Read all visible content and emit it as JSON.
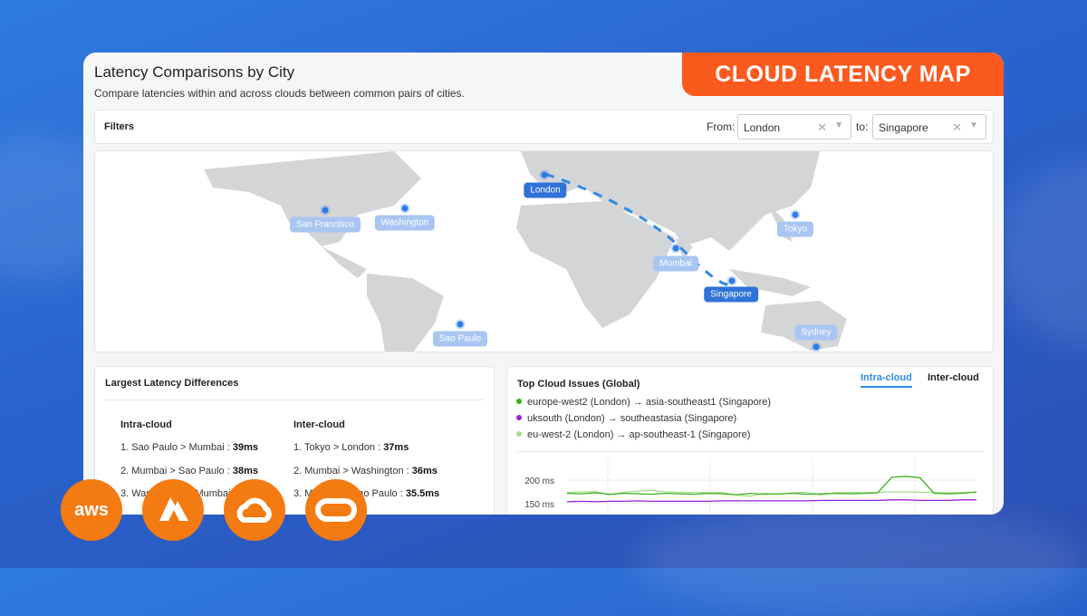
{
  "banner": "CLOUD LATENCY MAP",
  "header": {
    "title": "Latency Comparisons by City",
    "subtitle": "Compare latencies within and across clouds between common pairs of cities."
  },
  "filters": {
    "label": "Filters",
    "from_label": "From:",
    "from_value": "London",
    "to_label": "to:",
    "to_value": "Singapore"
  },
  "map": {
    "cities": [
      "San Francisco",
      "Washington",
      "London",
      "Mumbai",
      "Singapore",
      "Tokyo",
      "Sao Paulo",
      "Sydney"
    ],
    "selected": [
      "London",
      "Singapore"
    ]
  },
  "differences": {
    "title": "Largest Latency Differences",
    "intra": {
      "heading": "Intra-cloud",
      "items": [
        {
          "text": "1. Sao Paulo > Mumbai : ",
          "value": "39ms"
        },
        {
          "text": "2. Mumbai > Sao Paulo : ",
          "value": "38ms"
        },
        {
          "text": "3. Washington > Mumbai : ",
          "value": ""
        }
      ]
    },
    "inter": {
      "heading": "Inter-cloud",
      "items": [
        {
          "text": "1. Tokyo > London : ",
          "value": "37ms"
        },
        {
          "text": "2. Mumbai > Washington : ",
          "value": "36ms"
        },
        {
          "text": "3. Mumbai > Sao Paulo : ",
          "value": "35.5ms"
        }
      ]
    }
  },
  "issues": {
    "title": "Top Cloud Issues (Global)",
    "tabs": [
      "Intra-cloud",
      "Inter-cloud"
    ],
    "active_tab": "Intra-cloud",
    "accent": "#2f8ae6"
  },
  "chart_data": {
    "type": "line",
    "yticks": [
      "200 ms",
      "150 ms"
    ],
    "ylim": [
      140,
      215
    ],
    "series": [
      {
        "name": "europe-west2 (London) → asia-southeast1 (Singapore)",
        "color": "#3cb01e",
        "values": [
          172,
          171,
          173,
          170,
          172,
          171,
          170,
          172,
          171,
          170,
          172,
          171,
          169,
          172,
          170,
          171,
          172,
          170,
          171,
          172,
          171,
          172,
          173,
          206,
          208,
          205,
          172,
          171,
          172,
          175
        ]
      },
      {
        "name": "uksouth (London) → southeastasia (Singapore)",
        "color": "#9b1fd6",
        "values": [
          154,
          155,
          154,
          155,
          155,
          156,
          155,
          155,
          155,
          155,
          155,
          156,
          156,
          156,
          156,
          156,
          156,
          156,
          157,
          157,
          157,
          157,
          157,
          158,
          158,
          157,
          157,
          157,
          158,
          158
        ]
      },
      {
        "name": "eu-west-2 (London) → ap-southeast-1 (Singapore)",
        "color": "#a6df8c",
        "values": [
          174,
          175,
          176,
          169,
          174,
          177,
          178,
          175,
          174,
          174,
          173,
          174,
          168,
          166,
          172,
          170,
          173,
          174,
          168,
          173,
          174,
          173,
          174,
          175,
          175,
          174,
          174,
          173,
          174,
          174
        ]
      }
    ]
  },
  "logos": [
    "aws",
    "azure",
    "google-cloud",
    "oracle"
  ]
}
